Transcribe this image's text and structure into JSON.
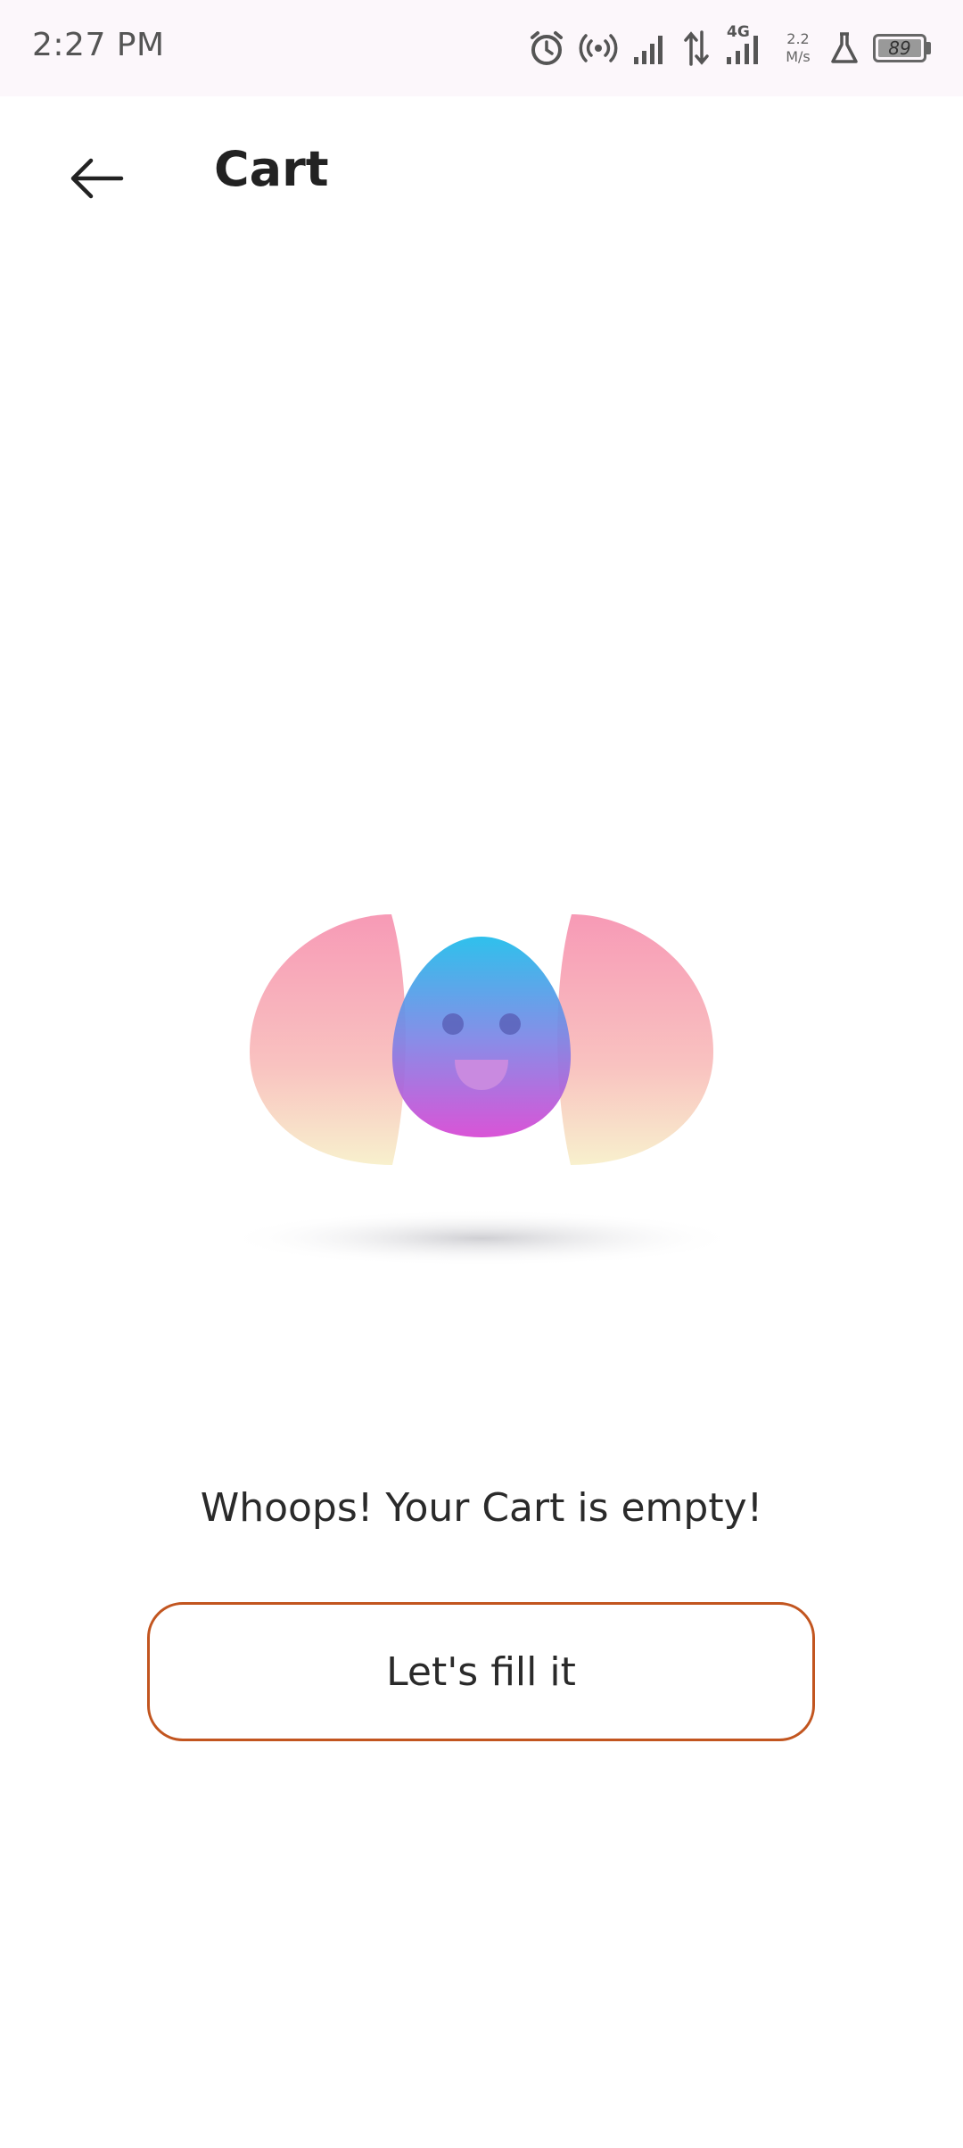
{
  "status_bar": {
    "time": "2:27 PM",
    "network_type": "4G",
    "speed_value": "2.2",
    "speed_unit": "M/s",
    "battery_level": "89",
    "icons": [
      "alarm-icon",
      "hotspot-icon",
      "signal-icon",
      "data-transfer-icon",
      "signal-4g-icon",
      "lab-icon",
      "battery-icon"
    ]
  },
  "header": {
    "title": "Cart",
    "back_icon": "arrow-left-icon"
  },
  "empty_state": {
    "illustration": "smiling-face-illustration",
    "message": "Whoops! Your Cart is empty!",
    "cta_label": "Let's fill it"
  },
  "colors": {
    "status_bar_bg": "#fcf7fb",
    "button_border": "#c2551f",
    "text_primary": "#222222"
  }
}
